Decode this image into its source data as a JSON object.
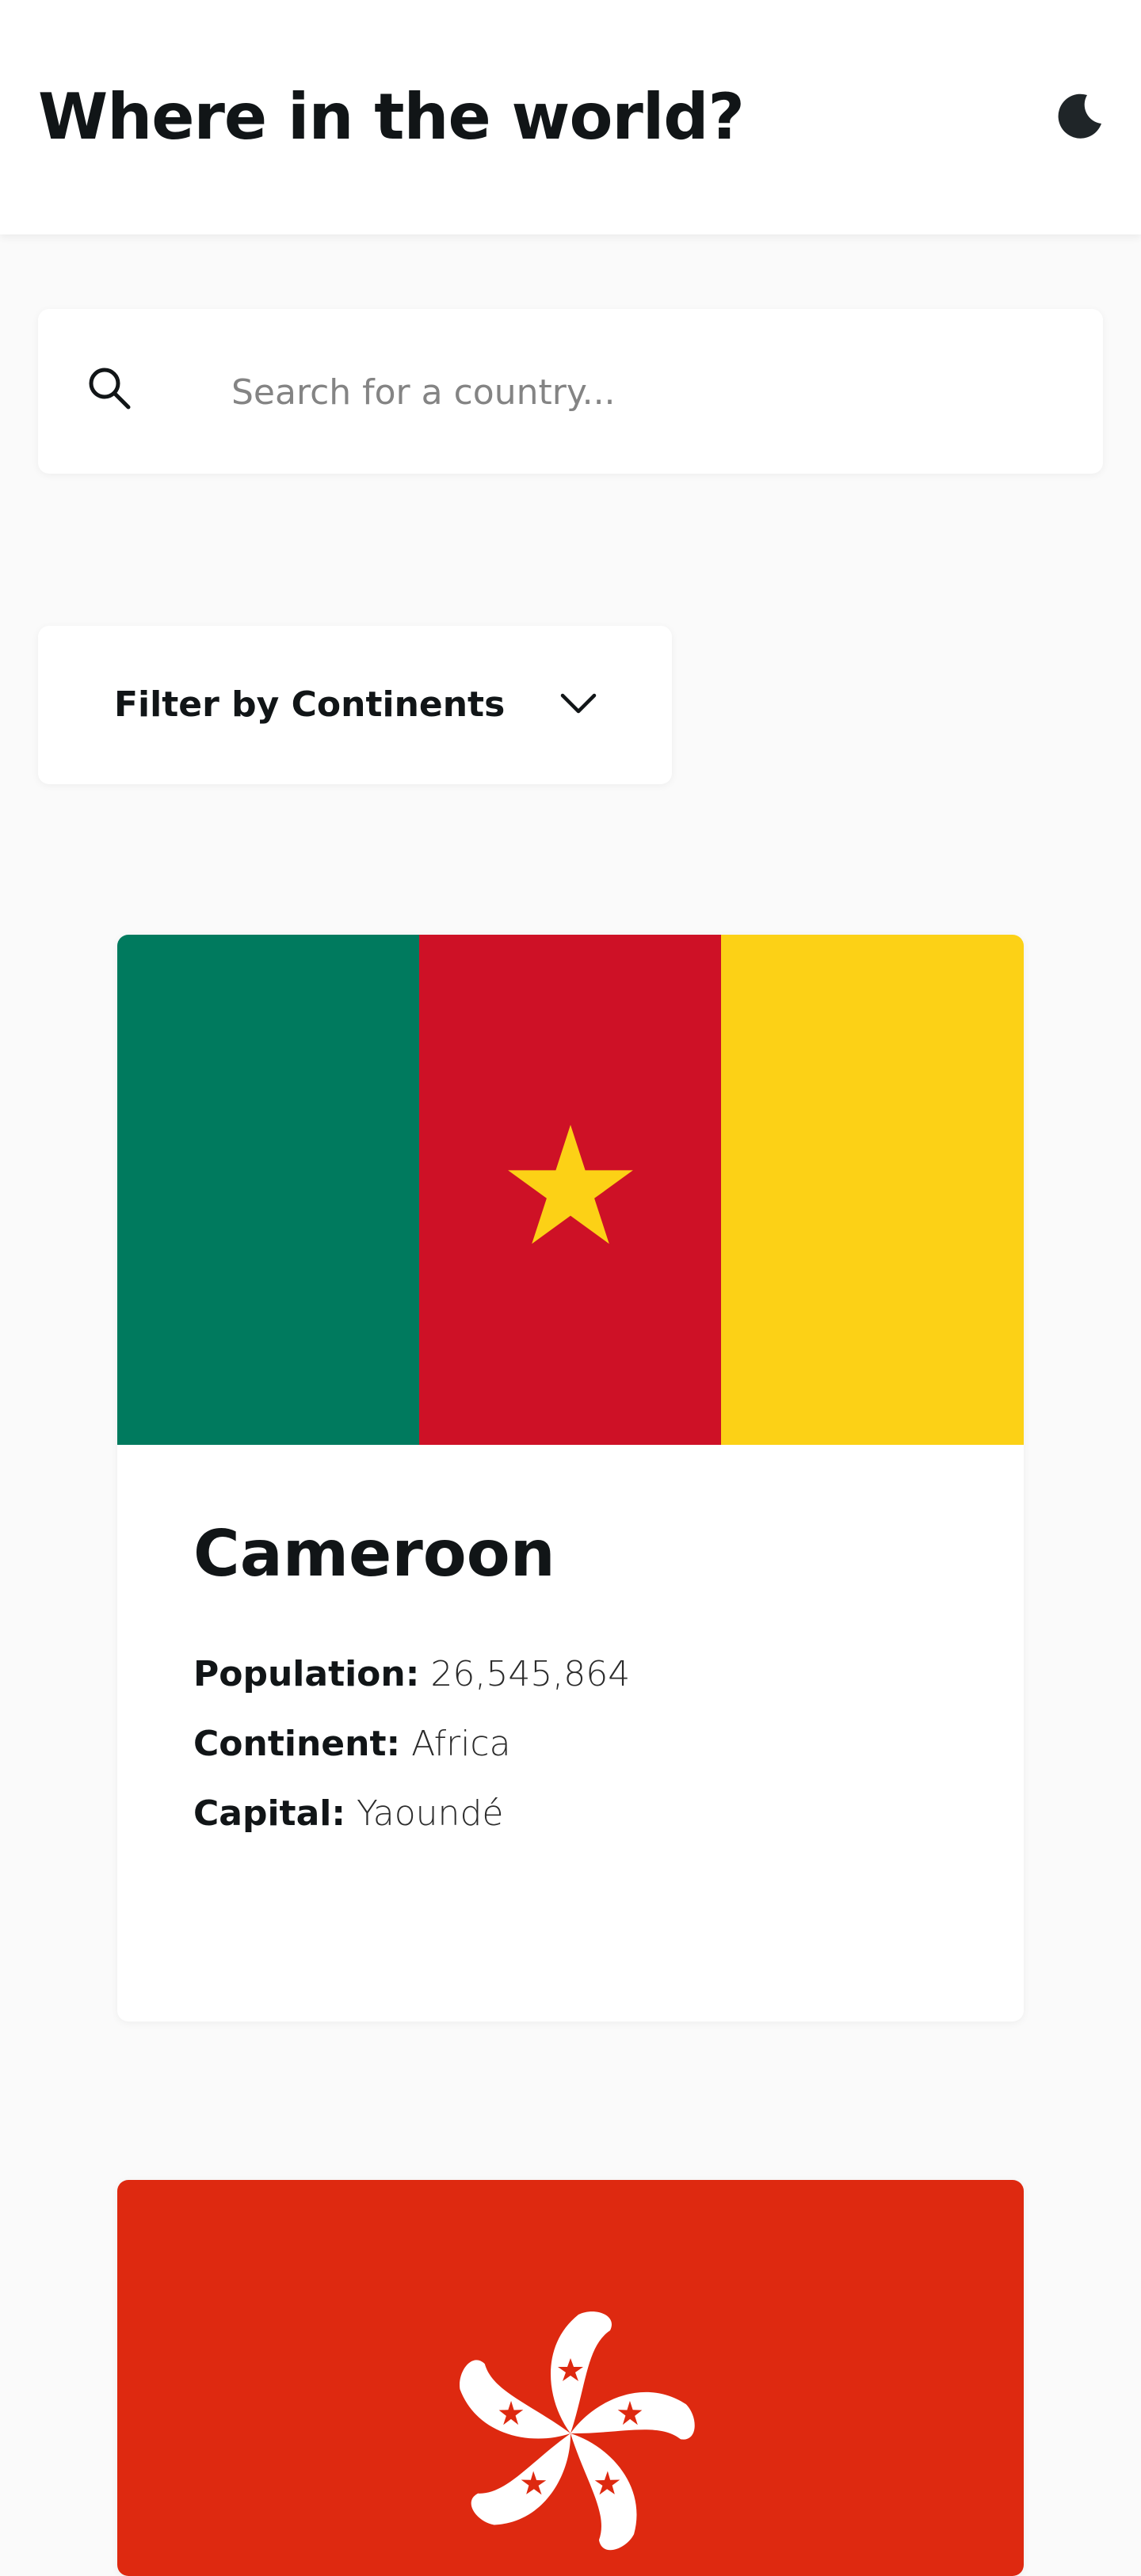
{
  "header": {
    "title": "Where in the world?",
    "theme_icon": "moon-icon"
  },
  "search": {
    "icon": "search-icon",
    "placeholder": "Search for a country...",
    "value": ""
  },
  "filter": {
    "label": "Filter by Continents",
    "icon": "chevron-down-icon"
  },
  "countries": [
    {
      "name": "Cameroon",
      "population_label": "Population:",
      "population": "26,545,864",
      "continent_label": "Continent:",
      "continent": "Africa",
      "capital_label": "Capital:",
      "capital": "Yaoundé",
      "flag_colors": [
        "#007a5e",
        "#ce1126",
        "#fcd116"
      ]
    },
    {
      "flag_colors": [
        "#de2910",
        "#ffffff"
      ]
    }
  ],
  "colors": {
    "background": "#fafafa",
    "surface": "#ffffff",
    "text": "#111517",
    "placeholder": "#848484"
  }
}
